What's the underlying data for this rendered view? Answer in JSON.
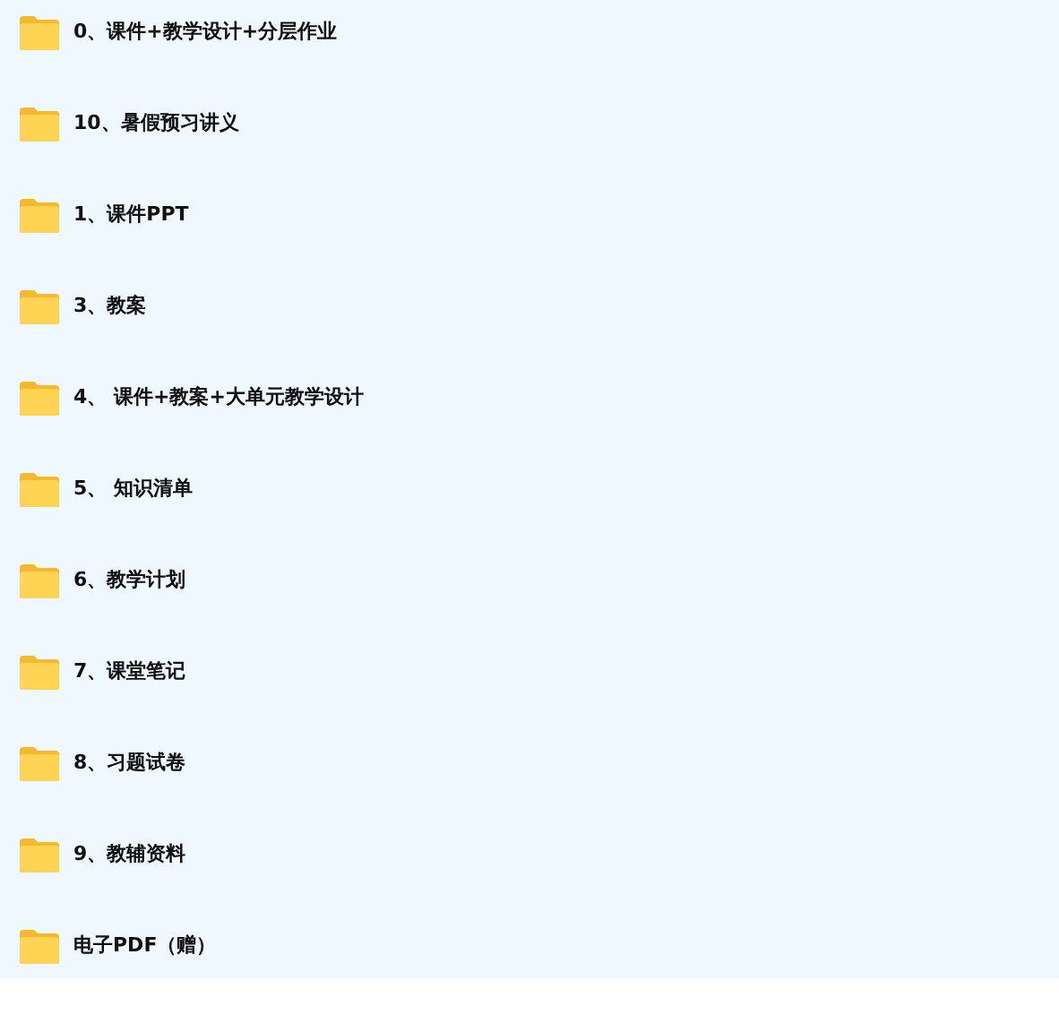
{
  "folders": [
    {
      "name": "0、课件+教学设计+分层作业"
    },
    {
      "name": "10、暑假预习讲义"
    },
    {
      "name": "1、课件PPT"
    },
    {
      "name": "3、教案"
    },
    {
      "name": "4、 课件+教案+大单元教学设计"
    },
    {
      "name": "5、 知识清单"
    },
    {
      "name": "6、教学计划"
    },
    {
      "name": "7、课堂笔记"
    },
    {
      "name": "8、习题试卷"
    },
    {
      "name": "9、教辅资料"
    },
    {
      "name": "电子PDF（赠）"
    }
  ]
}
